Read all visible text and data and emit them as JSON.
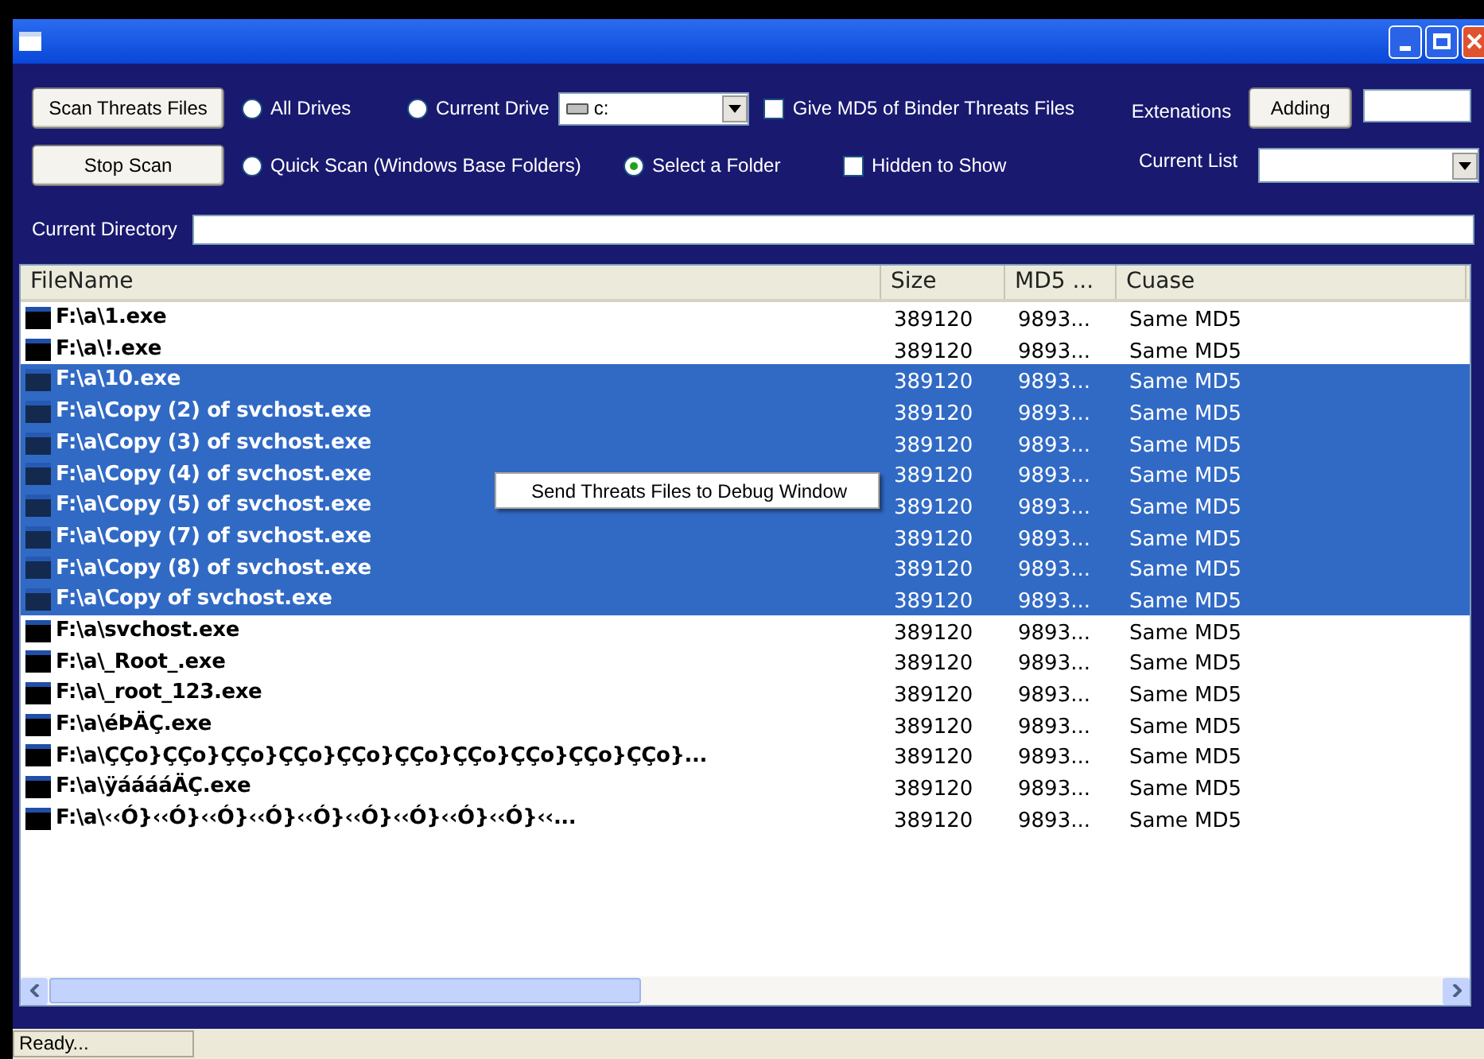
{
  "toolbar": {
    "scan_button": "Scan Threats Files",
    "stop_button": "Stop Scan",
    "radios": [
      {
        "label": "All Drives",
        "selected": false
      },
      {
        "label": "Current Drive",
        "selected": false
      },
      {
        "label": "Quick Scan (Windows Base Folders)",
        "selected": false
      },
      {
        "label": "Select a Folder",
        "selected": true
      }
    ],
    "drive": {
      "value": "c:"
    },
    "checkboxes": [
      {
        "label": "Give MD5 of Binder Threats Files",
        "checked": false
      },
      {
        "label": "Hidden to Show",
        "checked": false
      }
    ],
    "extensions_label": "Extenations",
    "adding_button": "Adding",
    "current_list_label": "Current List",
    "current_directory_label": "Current Directory"
  },
  "table": {
    "columns": [
      "FileName",
      "Size",
      "MD5 ...",
      "Cuase"
    ],
    "rows": [
      {
        "cells": [
          "F:\\a\\1.exe",
          "389120",
          "9893...",
          "Same MD5"
        ],
        "selected": false
      },
      {
        "cells": [
          "F:\\a\\!.exe",
          "389120",
          "9893...",
          "Same MD5"
        ],
        "selected": false
      },
      {
        "cells": [
          "F:\\a\\10.exe",
          "389120",
          "9893...",
          "Same MD5"
        ],
        "selected": true
      },
      {
        "cells": [
          "F:\\a\\Copy (2) of svchost.exe",
          "389120",
          "9893...",
          "Same MD5"
        ],
        "selected": true
      },
      {
        "cells": [
          "F:\\a\\Copy (3) of svchost.exe",
          "389120",
          "9893...",
          "Same MD5"
        ],
        "selected": true
      },
      {
        "cells": [
          "F:\\a\\Copy (4) of svchost.exe",
          "389120",
          "9893...",
          "Same MD5"
        ],
        "selected": true
      },
      {
        "cells": [
          "F:\\a\\Copy (5) of svchost.exe",
          "389120",
          "9893...",
          "Same MD5"
        ],
        "selected": true
      },
      {
        "cells": [
          "F:\\a\\Copy (7) of svchost.exe",
          "389120",
          "9893...",
          "Same MD5"
        ],
        "selected": true
      },
      {
        "cells": [
          "F:\\a\\Copy (8) of svchost.exe",
          "389120",
          "9893...",
          "Same MD5"
        ],
        "selected": true
      },
      {
        "cells": [
          "F:\\a\\Copy of svchost.exe",
          "389120",
          "9893...",
          "Same MD5"
        ],
        "selected": true
      },
      {
        "cells": [
          "F:\\a\\svchost.exe",
          "389120",
          "9893...",
          "Same MD5"
        ],
        "selected": false
      },
      {
        "cells": [
          "F:\\a\\_Root_.exe",
          "389120",
          "9893...",
          "Same MD5"
        ],
        "selected": false
      },
      {
        "cells": [
          "F:\\a\\_root_123.exe",
          "389120",
          "9893...",
          "Same MD5"
        ],
        "selected": false
      },
      {
        "cells": [
          "F:\\a\\éÞÄÇ.exe",
          "389120",
          "9893...",
          "Same MD5"
        ],
        "selected": false
      },
      {
        "cells": [
          "F:\\a\\ÇÇo}ÇÇo}ÇÇo}ÇÇo}ÇÇo}ÇÇo}ÇÇo}ÇÇo}ÇÇo}ÇÇo}...",
          "389120",
          "9893...",
          "Same MD5"
        ],
        "selected": false
      },
      {
        "cells": [
          "F:\\a\\ÿááááÄÇ.exe",
          "389120",
          "9893...",
          "Same MD5"
        ],
        "selected": false
      },
      {
        "cells": [
          "F:\\a\\‹‹Ó}‹‹Ó}‹‹Ó}‹‹Ó}‹‹Ó}‹‹Ó}‹‹Ó}‹‹Ó}‹‹Ó}‹‹...",
          "389120",
          "9893...",
          "Same MD5"
        ],
        "selected": false
      }
    ]
  },
  "context_menu": {
    "items": [
      "Send Threats Files to Debug Window"
    ]
  },
  "status_bar": {
    "text": "Ready..."
  }
}
